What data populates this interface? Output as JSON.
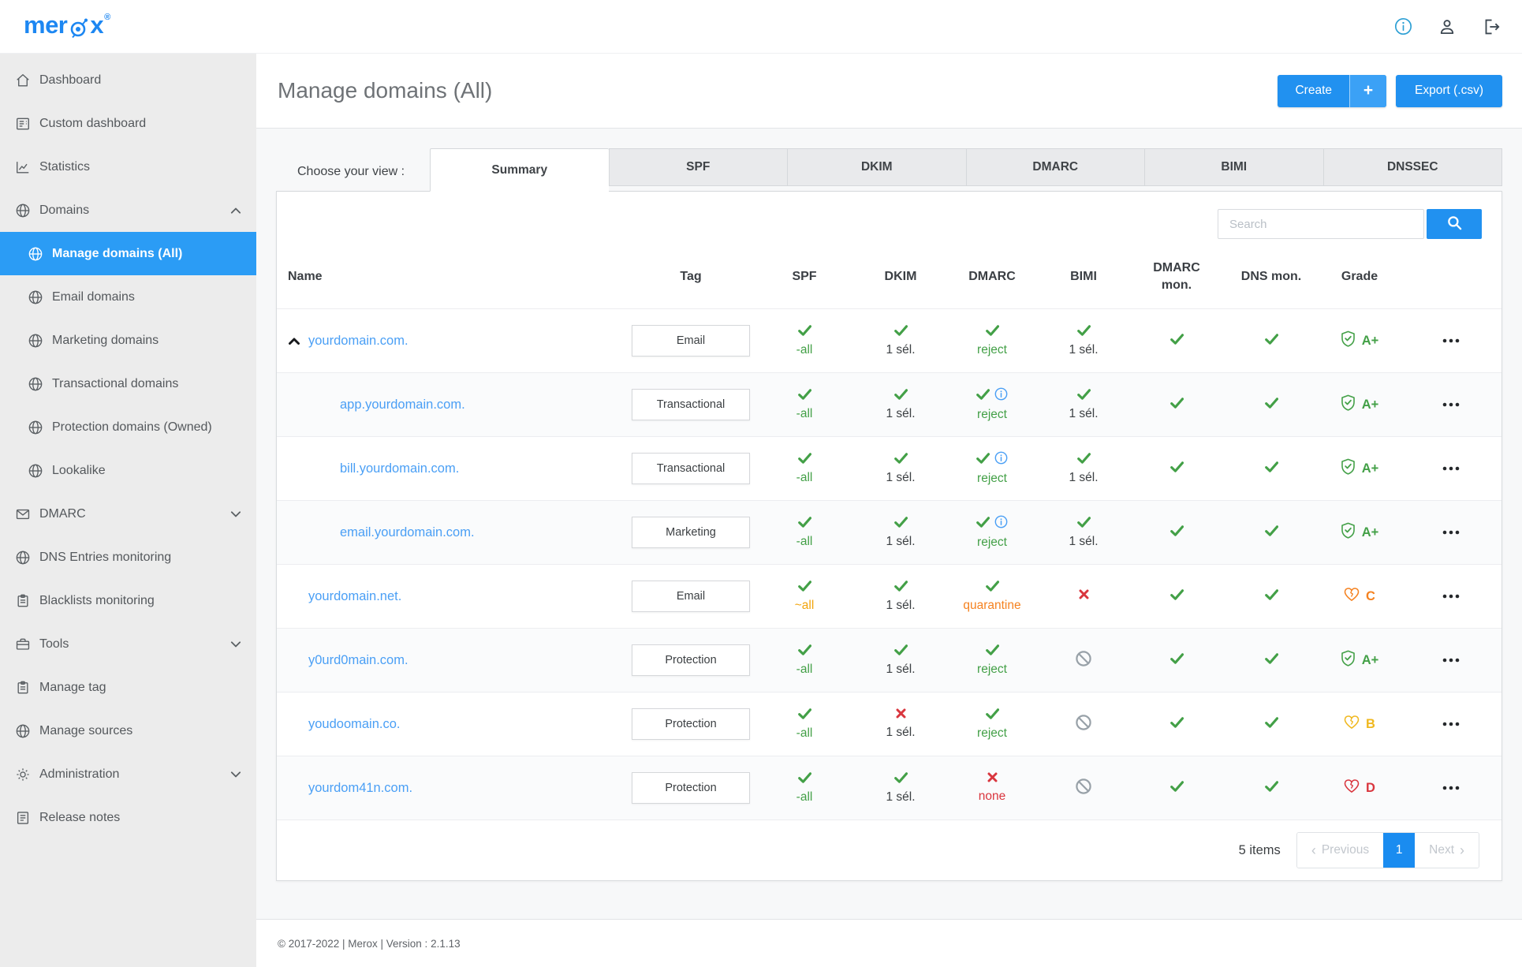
{
  "topbar": {
    "logo": {
      "part1": "mer",
      "part2": "x",
      "registered": "®"
    }
  },
  "sidebar": {
    "items": [
      {
        "label": "Dashboard",
        "icon": "home"
      },
      {
        "label": "Custom dashboard",
        "icon": "doc"
      },
      {
        "label": "Statistics",
        "icon": "chart"
      },
      {
        "label": "Domains",
        "icon": "globe",
        "chevron": "up"
      },
      {
        "label": "Manage domains (All)",
        "icon": "globe",
        "sub": true,
        "active": true
      },
      {
        "label": "Email domains",
        "icon": "globe",
        "sub": true
      },
      {
        "label": "Marketing domains",
        "icon": "globe",
        "sub": true
      },
      {
        "label": "Transactional domains",
        "icon": "globe",
        "sub": true
      },
      {
        "label": "Protection domains (Owned)",
        "icon": "globe",
        "sub": true
      },
      {
        "label": "Lookalike",
        "icon": "globe",
        "sub": true
      },
      {
        "label": "DMARC",
        "icon": "mail",
        "chevron": "down"
      },
      {
        "label": "DNS Entries monitoring",
        "icon": "globe"
      },
      {
        "label": "Blacklists monitoring",
        "icon": "clipboard"
      },
      {
        "label": "Tools",
        "icon": "briefcase",
        "chevron": "down"
      },
      {
        "label": "Manage tag",
        "icon": "clipboard"
      },
      {
        "label": "Manage sources",
        "icon": "globe"
      },
      {
        "label": "Administration",
        "icon": "gear",
        "chevron": "down"
      },
      {
        "label": "Release notes",
        "icon": "note"
      }
    ]
  },
  "header": {
    "title": "Manage domains (All)",
    "create_label": "Create",
    "create_plus": "+",
    "export_label": "Export (.csv)"
  },
  "view_bar": {
    "label": "Choose your view :",
    "tabs": [
      {
        "label": "Summary",
        "active": true
      },
      {
        "label": "SPF"
      },
      {
        "label": "DKIM"
      },
      {
        "label": "DMARC"
      },
      {
        "label": "BIMI"
      },
      {
        "label": "DNSSEC"
      }
    ]
  },
  "search": {
    "placeholder": "Search"
  },
  "table": {
    "columns": [
      "Name",
      "Tag",
      "SPF",
      "DKIM",
      "DMARC",
      "BIMI",
      "DMARC mon.",
      "DNS mon.",
      "Grade"
    ],
    "rows": [
      {
        "name": "yourdomain.com.",
        "indent": 0,
        "caret": true,
        "tag": "Email",
        "spf": {
          "icon": "check",
          "label": "-all",
          "color": "green"
        },
        "dkim": {
          "icon": "check",
          "label": "1 sél.",
          "color": "dark"
        },
        "dmarc": {
          "icon": "check",
          "info": false,
          "label": "reject",
          "color": "green"
        },
        "bimi": {
          "icon": "check",
          "label": "1 sél.",
          "color": "dark"
        },
        "dmarc_mon": {
          "icon": "check"
        },
        "dns_mon": {
          "icon": "check"
        },
        "grade": {
          "icon": "shield-check",
          "label": "A+",
          "color": "green"
        }
      },
      {
        "name": "app.yourdomain.com.",
        "indent": 1,
        "caret": false,
        "tag": "Transactional",
        "spf": {
          "icon": "check",
          "label": "-all",
          "color": "green"
        },
        "dkim": {
          "icon": "check",
          "label": "1 sél.",
          "color": "dark"
        },
        "dmarc": {
          "icon": "check",
          "info": true,
          "label": "reject",
          "color": "green"
        },
        "bimi": {
          "icon": "check",
          "label": "1 sél.",
          "color": "dark"
        },
        "dmarc_mon": {
          "icon": "check"
        },
        "dns_mon": {
          "icon": "check"
        },
        "grade": {
          "icon": "shield-check",
          "label": "A+",
          "color": "green"
        }
      },
      {
        "name": "bill.yourdomain.com.",
        "indent": 1,
        "caret": false,
        "tag": "Transactional",
        "spf": {
          "icon": "check",
          "label": "-all",
          "color": "green"
        },
        "dkim": {
          "icon": "check",
          "label": "1 sél.",
          "color": "dark"
        },
        "dmarc": {
          "icon": "check",
          "info": true,
          "label": "reject",
          "color": "green"
        },
        "bimi": {
          "icon": "check",
          "label": "1 sél.",
          "color": "dark"
        },
        "dmarc_mon": {
          "icon": "check"
        },
        "dns_mon": {
          "icon": "check"
        },
        "grade": {
          "icon": "shield-check",
          "label": "A+",
          "color": "green"
        }
      },
      {
        "name": "email.yourdomain.com.",
        "indent": 1,
        "caret": false,
        "tag": "Marketing",
        "spf": {
          "icon": "check",
          "label": "-all",
          "color": "green"
        },
        "dkim": {
          "icon": "check",
          "label": "1 sél.",
          "color": "dark"
        },
        "dmarc": {
          "icon": "check",
          "info": true,
          "label": "reject",
          "color": "green"
        },
        "bimi": {
          "icon": "check",
          "label": "1 sél.",
          "color": "dark"
        },
        "dmarc_mon": {
          "icon": "check"
        },
        "dns_mon": {
          "icon": "check"
        },
        "grade": {
          "icon": "shield-check",
          "label": "A+",
          "color": "green"
        }
      },
      {
        "name": "yourdomain.net.",
        "indent": 0,
        "caret": false,
        "tag": "Email",
        "spf": {
          "icon": "check",
          "label": "~all",
          "color": "amber"
        },
        "dkim": {
          "icon": "check",
          "label": "1 sél.",
          "color": "dark"
        },
        "dmarc": {
          "icon": "check",
          "info": false,
          "label": "quarantine",
          "color": "orange"
        },
        "bimi": {
          "icon": "x"
        },
        "dmarc_mon": {
          "icon": "check"
        },
        "dns_mon": {
          "icon": "check"
        },
        "grade": {
          "icon": "heart-crack",
          "label": "C",
          "color": "orange"
        }
      },
      {
        "name": "y0urd0main.com.",
        "indent": 0,
        "caret": false,
        "tag": "Protection",
        "spf": {
          "icon": "check",
          "label": "-all",
          "color": "green"
        },
        "dkim": {
          "icon": "check",
          "label": "1 sél.",
          "color": "dark"
        },
        "dmarc": {
          "icon": "check",
          "info": false,
          "label": "reject",
          "color": "green"
        },
        "bimi": {
          "icon": "ban"
        },
        "dmarc_mon": {
          "icon": "check"
        },
        "dns_mon": {
          "icon": "check"
        },
        "grade": {
          "icon": "shield-check",
          "label": "A+",
          "color": "green"
        }
      },
      {
        "name": "youdoomain.co.",
        "indent": 0,
        "caret": false,
        "tag": "Protection",
        "spf": {
          "icon": "check",
          "label": "-all",
          "color": "green"
        },
        "dkim": {
          "icon": "x",
          "label": "1 sél.",
          "color": "dark"
        },
        "dmarc": {
          "icon": "check",
          "info": false,
          "label": "reject",
          "color": "green"
        },
        "bimi": {
          "icon": "ban"
        },
        "dmarc_mon": {
          "icon": "check"
        },
        "dns_mon": {
          "icon": "check"
        },
        "grade": {
          "icon": "heart-crack",
          "label": "B",
          "color": "yellow"
        }
      },
      {
        "name": "yourdom41n.com.",
        "indent": 0,
        "caret": false,
        "tag": "Protection",
        "spf": {
          "icon": "check",
          "label": "-all",
          "color": "green"
        },
        "dkim": {
          "icon": "check",
          "label": "1 sél.",
          "color": "dark"
        },
        "dmarc": {
          "icon": "x",
          "info": false,
          "label": "none",
          "color": "red"
        },
        "bimi": {
          "icon": "ban"
        },
        "dmarc_mon": {
          "icon": "check"
        },
        "dns_mon": {
          "icon": "check"
        },
        "grade": {
          "icon": "heart-crack",
          "label": "D",
          "color": "red"
        }
      }
    ]
  },
  "pagination": {
    "count": "5 items",
    "previous": "Previous",
    "page": "1",
    "next": "Next"
  },
  "footer": {
    "copyright": "© 2017-2022 | Merox | Version : 2.1.13"
  },
  "colors": {
    "accent_blue": "#2191f0",
    "link_blue": "#4a9ff5",
    "sidebar_active": "#2b9cf5",
    "green": "#43a047",
    "orange": "#f58220",
    "amber": "#f2a50c",
    "yellow": "#f0b81f",
    "red": "#d9363e",
    "ban_gray": "#98a1a8",
    "page_bg": "#f7f8f9",
    "sidebar_bg": "#ececec"
  }
}
